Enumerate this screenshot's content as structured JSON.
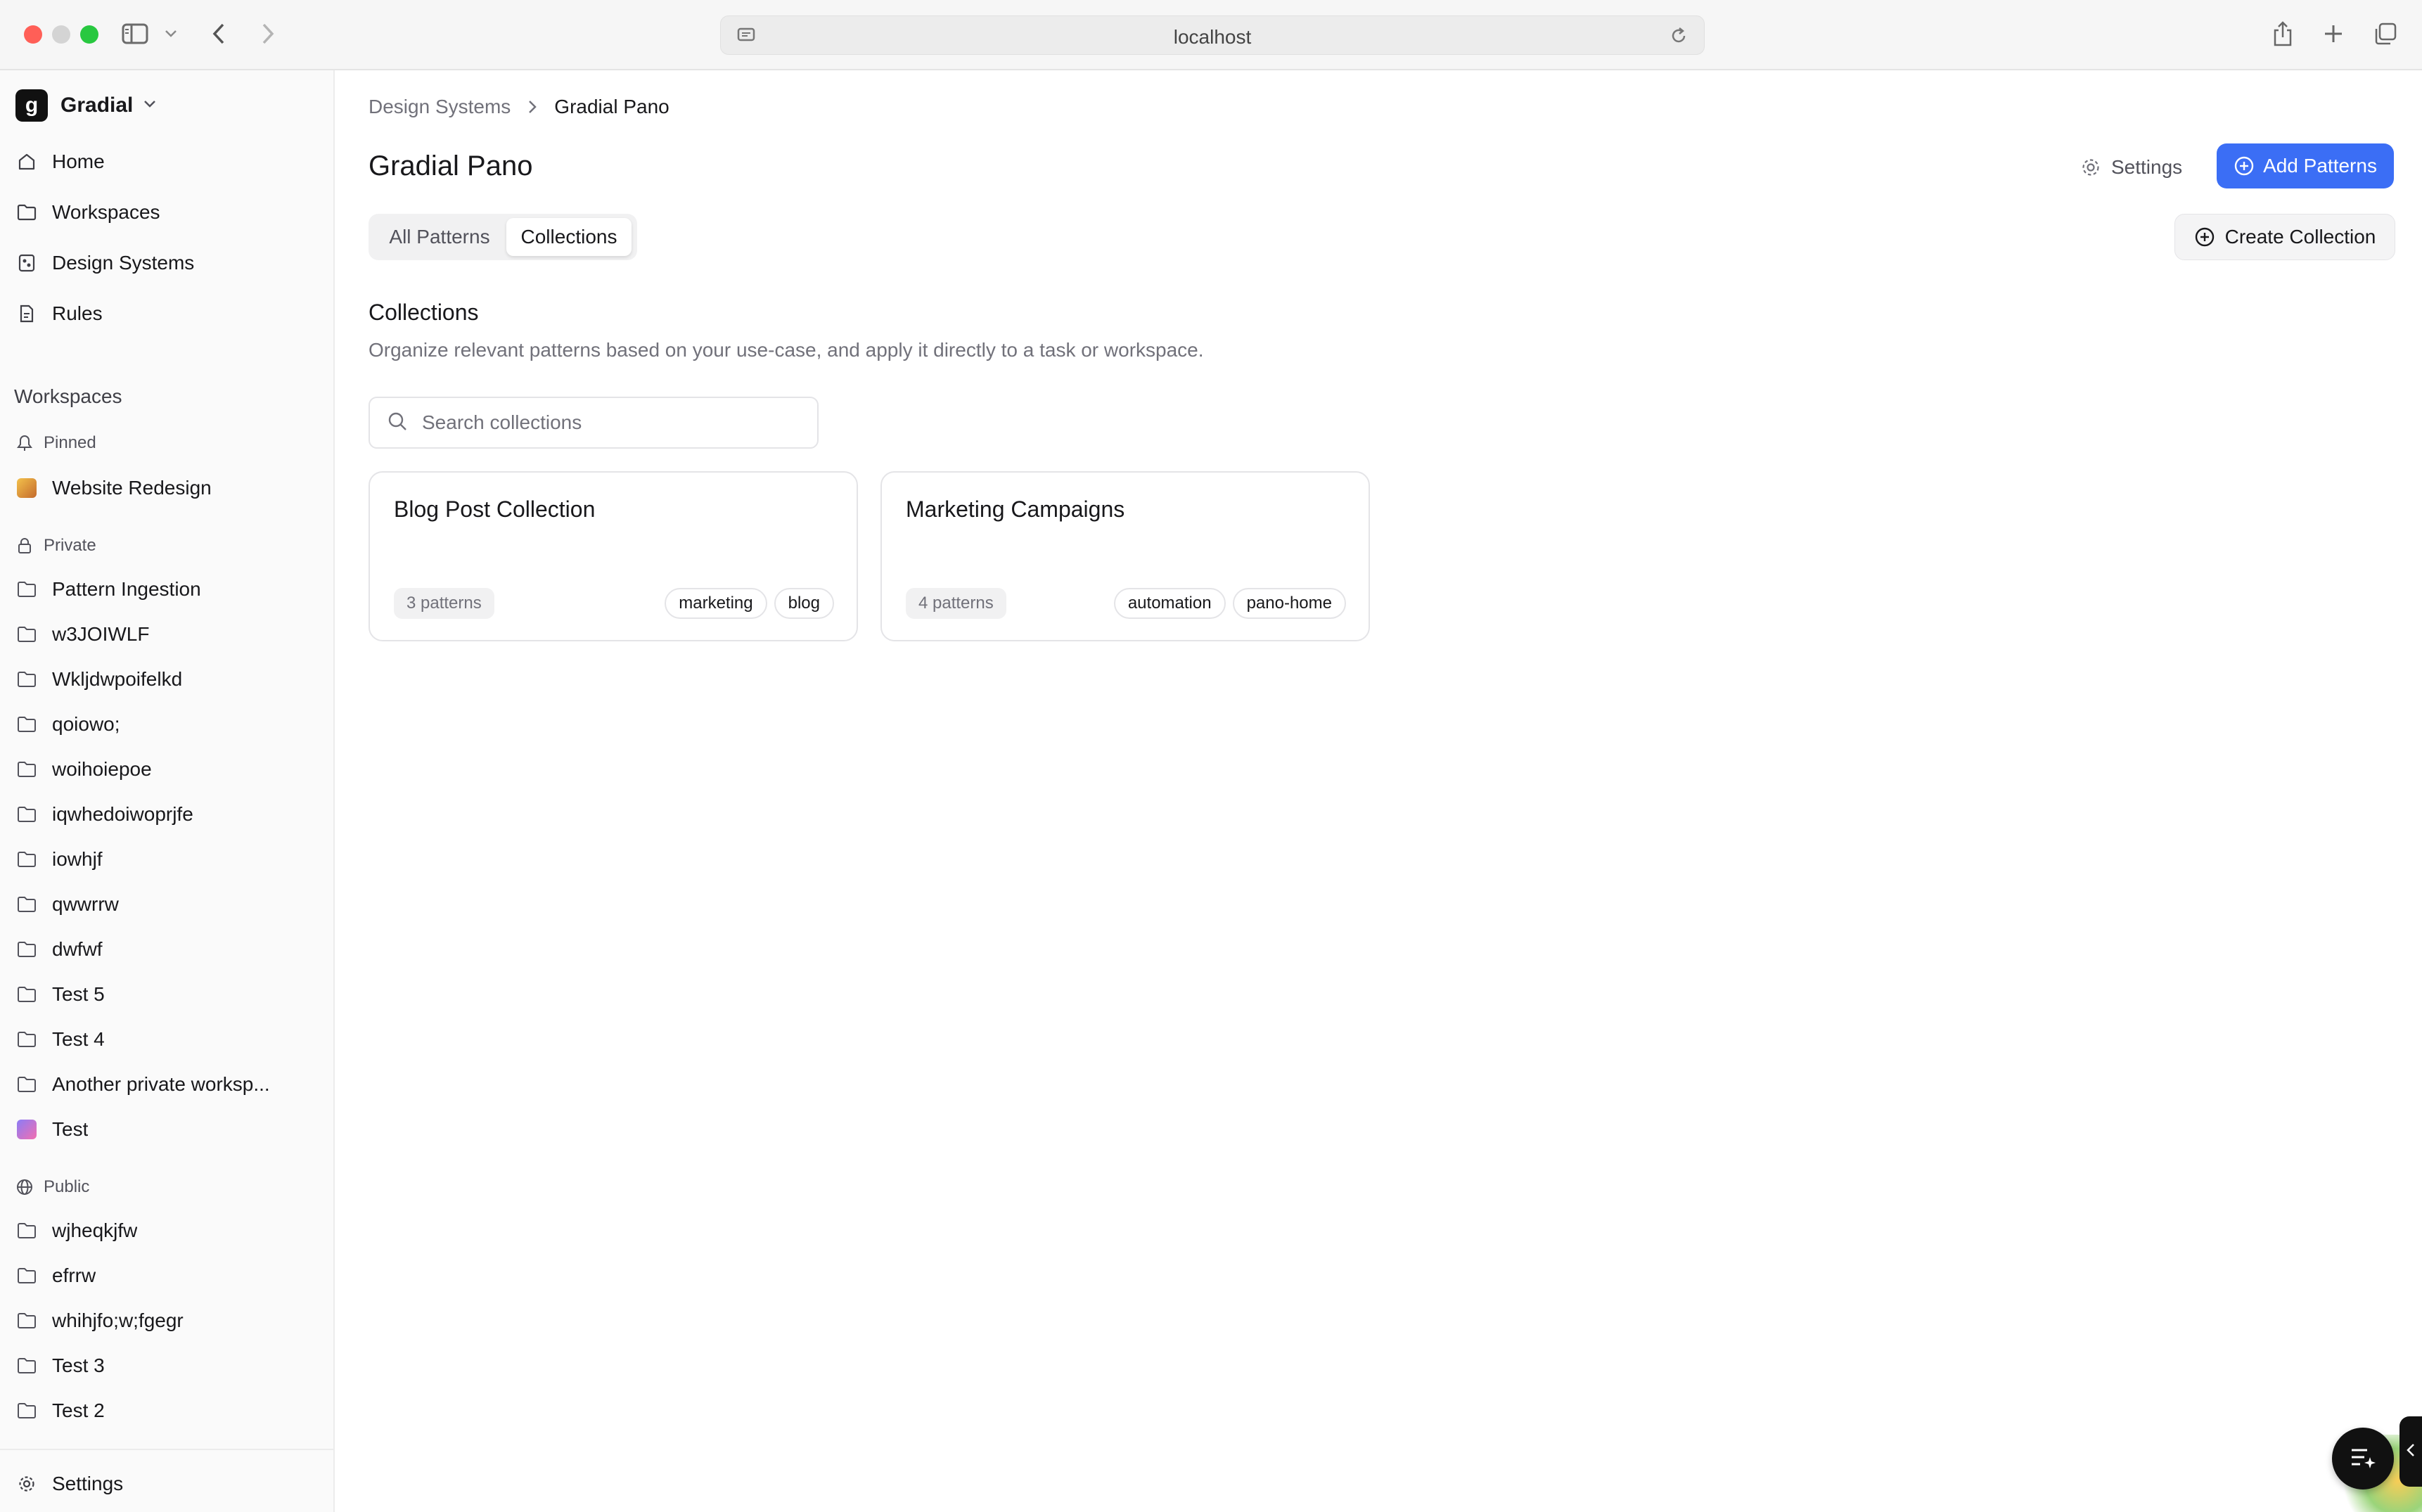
{
  "browser": {
    "url": "localhost"
  },
  "sidebar": {
    "brand": {
      "name": "Gradial",
      "logo_letter": "g"
    },
    "nav": [
      {
        "label": "Home",
        "icon": "home-icon"
      },
      {
        "label": "Workspaces",
        "icon": "folder-icon"
      },
      {
        "label": "Design Systems",
        "icon": "design-systems-icon"
      },
      {
        "label": "Rules",
        "icon": "rules-icon"
      }
    ],
    "workspaces_title": "Workspaces",
    "pinned": {
      "label": "Pinned",
      "items": [
        {
          "label": "Website Redesign",
          "icon": "workspace-avatar-icon"
        }
      ]
    },
    "private": {
      "label": "Private",
      "items": [
        {
          "label": "Pattern Ingestion"
        },
        {
          "label": "w3JOIWLF"
        },
        {
          "label": "Wkljdwpoifelkd"
        },
        {
          "label": "qoiowo;"
        },
        {
          "label": "woihoiepoe"
        },
        {
          "label": "iqwhedoiwoprjfe"
        },
        {
          "label": "iowhjf"
        },
        {
          "label": "qwwrrw"
        },
        {
          "label": "dwfwf"
        },
        {
          "label": "Test 5"
        },
        {
          "label": "Test 4"
        },
        {
          "label": "Another private worksp..."
        },
        {
          "label": "Test"
        }
      ]
    },
    "public": {
      "label": "Public",
      "items": [
        {
          "label": "wjheqkjfw"
        },
        {
          "label": "efrrw"
        },
        {
          "label": "whihjfo;w;fgegr"
        },
        {
          "label": "Test 3"
        },
        {
          "label": "Test 2"
        }
      ]
    },
    "footer": {
      "settings_label": "Settings"
    }
  },
  "main": {
    "breadcrumb": {
      "parent": "Design Systems",
      "current": "Gradial Pano"
    },
    "title": "Gradial Pano",
    "settings_label": "Settings",
    "add_patterns_label": "Add Patterns",
    "tabs": [
      {
        "label": "All Patterns",
        "active": false
      },
      {
        "label": "Collections",
        "active": true
      }
    ],
    "create_collection_label": "Create Collection",
    "section": {
      "title": "Collections",
      "description": "Organize relevant patterns based on your use-case, and apply it directly to a task or workspace."
    },
    "search": {
      "placeholder": "Search collections",
      "value": ""
    },
    "collections": [
      {
        "title": "Blog Post Collection",
        "count": "3 patterns",
        "tags": [
          "marketing",
          "blog"
        ]
      },
      {
        "title": "Marketing Campaigns",
        "count": "4 patterns",
        "tags": [
          "automation",
          "pano-home"
        ]
      }
    ]
  },
  "colors": {
    "accent": "#3b6ef5",
    "traffic_red": "#ff5f57",
    "traffic_green": "#28c840"
  }
}
